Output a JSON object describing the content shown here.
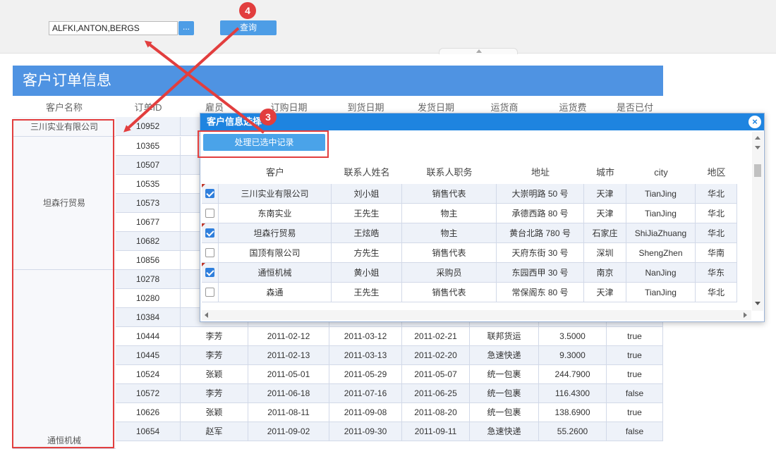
{
  "query": {
    "input_value": "ALFKI,ANTON,BERGS",
    "dots_label": "...",
    "query_label": "查询"
  },
  "report": {
    "title": "客户订单信息",
    "columns": [
      "客户名称",
      "订单ID",
      "雇员",
      "订购日期",
      "到货日期",
      "发货日期",
      "运货商",
      "运货费",
      "是否已付"
    ],
    "name_groups": [
      "三川实业有限公司",
      "坦森行贸易",
      "通恒机械"
    ],
    "rows": [
      [
        "10952",
        "",
        "",
        "",
        "",
        "",
        "",
        ""
      ],
      [
        "10365",
        "",
        "",
        "",
        "",
        "",
        "",
        ""
      ],
      [
        "10507",
        "",
        "",
        "",
        "",
        "",
        "",
        ""
      ],
      [
        "10535",
        "",
        "",
        "",
        "",
        "",
        "",
        ""
      ],
      [
        "10573",
        "",
        "",
        "",
        "",
        "",
        "",
        ""
      ],
      [
        "10677",
        "",
        "",
        "",
        "",
        "",
        "",
        ""
      ],
      [
        "10682",
        "",
        "",
        "",
        "",
        "",
        "",
        ""
      ],
      [
        "10856",
        "",
        "",
        "",
        "",
        "",
        "",
        ""
      ],
      [
        "10278",
        "",
        "",
        "",
        "",
        "",
        "",
        ""
      ],
      [
        "10280",
        "",
        "",
        "",
        "",
        "",
        "",
        ""
      ],
      [
        "10384",
        "",
        "",
        "",
        "",
        "",
        "",
        ""
      ],
      [
        "10444",
        "李芳",
        "2011-02-12",
        "2011-03-12",
        "2011-02-21",
        "联邦货运",
        "3.5000",
        "true"
      ],
      [
        "10445",
        "李芳",
        "2011-02-13",
        "2011-03-13",
        "2011-02-20",
        "急速快递",
        "9.3000",
        "true"
      ],
      [
        "10524",
        "张颖",
        "2011-05-01",
        "2011-05-29",
        "2011-05-07",
        "统一包裹",
        "244.7900",
        "true"
      ],
      [
        "10572",
        "李芳",
        "2011-06-18",
        "2011-07-16",
        "2011-06-25",
        "统一包裹",
        "116.4300",
        "false"
      ],
      [
        "10626",
        "张颖",
        "2011-08-11",
        "2011-09-08",
        "2011-08-20",
        "统一包裹",
        "138.6900",
        "true"
      ],
      [
        "10654",
        "赵军",
        "2011-09-02",
        "2011-09-30",
        "2011-09-11",
        "急速快递",
        "55.2600",
        "false"
      ]
    ]
  },
  "dialog": {
    "title": "客户信息选择",
    "close_icon": "×",
    "process_label": "处理已选中记录",
    "columns": [
      "客户",
      "联系人姓名",
      "联系人职务",
      "地址",
      "城市",
      "city",
      "地区"
    ],
    "rows": [
      {
        "checked": true,
        "cells": [
          "三川实业有限公司",
          "刘小姐",
          "销售代表",
          "大崇明路 50 号",
          "天津",
          "TianJing",
          "华北"
        ]
      },
      {
        "checked": false,
        "cells": [
          "东南实业",
          "王先生",
          "物主",
          "承德西路 80 号",
          "天津",
          "TianJing",
          "华北"
        ]
      },
      {
        "checked": true,
        "cells": [
          "坦森行贸易",
          "王炫皓",
          "物主",
          "黄台北路 780 号",
          "石家庄",
          "ShiJiaZhuang",
          "华北"
        ]
      },
      {
        "checked": false,
        "cells": [
          "国顶有限公司",
          "方先生",
          "销售代表",
          "天府东街 30 号",
          "深圳",
          "ShengZhen",
          "华南"
        ]
      },
      {
        "checked": true,
        "cells": [
          "通恒机械",
          "黄小姐",
          "采购员",
          "东园西甲 30 号",
          "南京",
          "NanJing",
          "华东"
        ]
      },
      {
        "checked": false,
        "cells": [
          "森通",
          "王先生",
          "销售代表",
          "常保阁东 80 号",
          "天津",
          "TianJing",
          "华北"
        ]
      }
    ]
  },
  "annotations": {
    "badge_3": "3",
    "badge_4": "4"
  },
  "colors": {
    "accent": "#4f93e2",
    "dialog_header": "#1e84e0",
    "annotation": "#e23e3e",
    "row_alt": "#eef2f9"
  },
  "icons": {
    "close": "close-icon",
    "scroll_up": "arrow-up-icon",
    "scroll_down": "arrow-down-icon",
    "scroll_left": "arrow-left-icon",
    "scroll_right": "arrow-right-icon",
    "collapse": "chevron-up-icon"
  }
}
